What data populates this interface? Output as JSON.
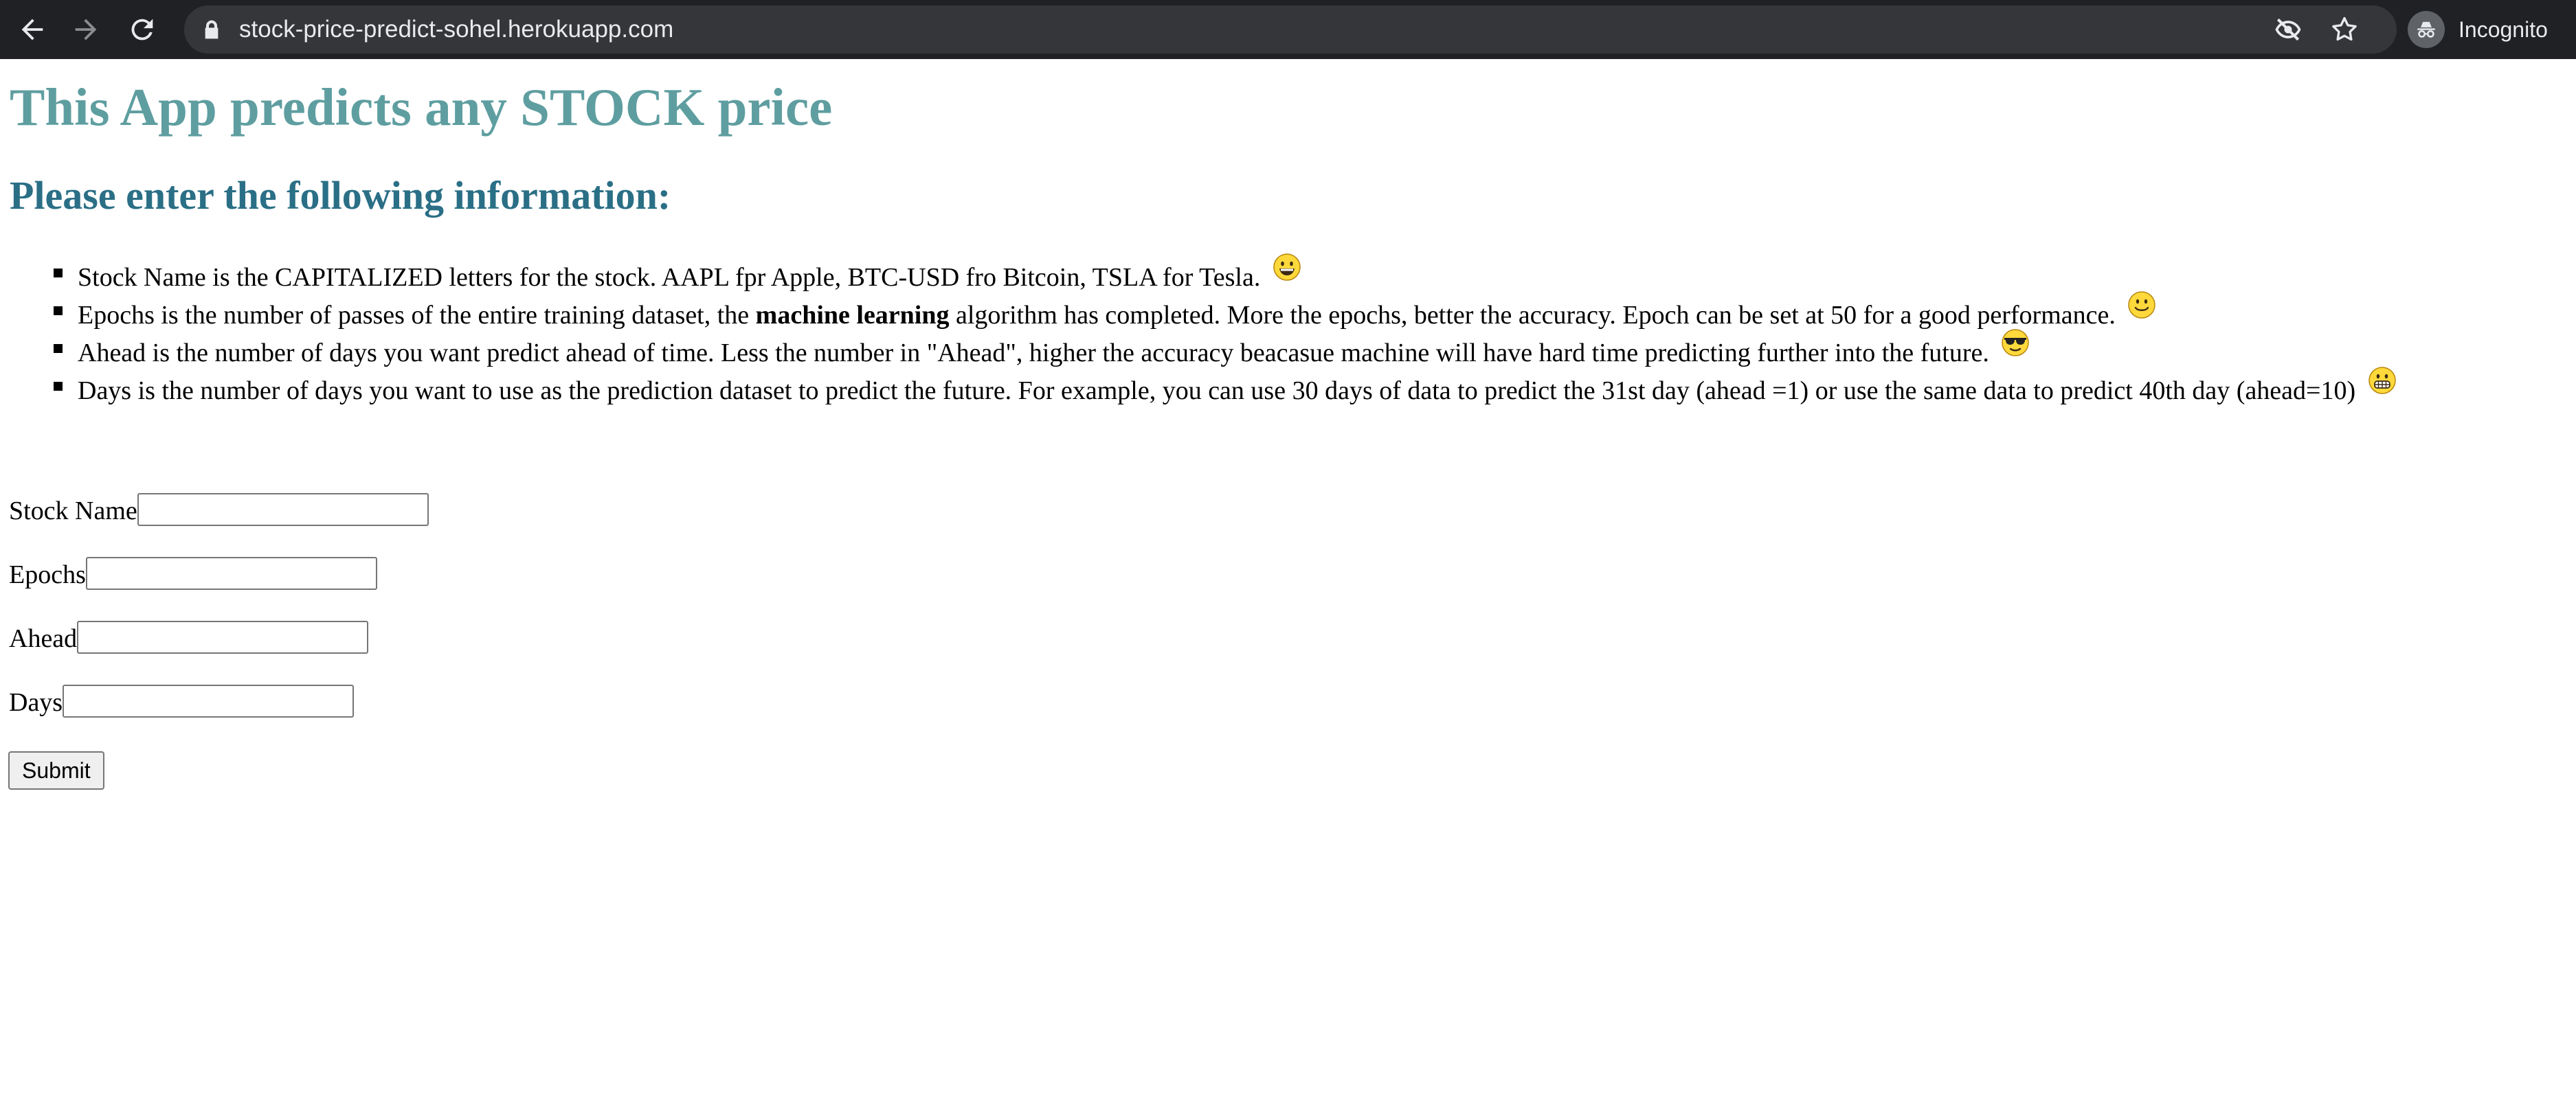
{
  "browser": {
    "url": "stock-price-predict-sohel.herokuapp.com",
    "profile_label": "Incognito",
    "icons": [
      "back-icon",
      "forward-icon",
      "reload-icon",
      "lock-icon",
      "eye-off-icon",
      "star-icon",
      "incognito-icon"
    ]
  },
  "page": {
    "title": "This App predicts any STOCK price",
    "subtitle": "Please enter the following information:",
    "info_items": [
      {
        "text": "Stock Name is the CAPITALIZED letters for the stock. AAPL fpr Apple, BTC-USD fro Bitcoin, TSLA for Tesla.",
        "emoji": "grinning-face-emoji"
      },
      {
        "pre": "Epochs is the number of passes of the entire training dataset, the ",
        "bold": "machine learning",
        "post": " algorithm has completed. More the epochs, better the accuracy. Epoch can be set at 50 for a good performance.",
        "emoji": "slightly-smiling-face-emoji"
      },
      {
        "text": "Ahead is the number of days you want predict ahead of time. Less the number in \"Ahead\", higher the accuracy beacasue machine will have hard time predicting further into the future.",
        "emoji": "sunglasses-face-emoji"
      },
      {
        "text": "Days is the number of days you want to use as the prediction dataset to predict the future. For example, you can use 30 days of data to predict the 31st day (ahead =1) or use the same data to predict 40th day (ahead=10)",
        "emoji": "grimacing-face-emoji"
      }
    ],
    "form": {
      "stock_name_label": "Stock Name",
      "stock_name_value": "",
      "epochs_label": "Epochs",
      "epochs_value": "",
      "ahead_label": "Ahead",
      "ahead_value": "",
      "days_label": "Days",
      "days_value": "",
      "submit_label": "Submit"
    }
  },
  "colors": {
    "title": "#5f9ea0",
    "subtitle": "#2a6f86",
    "chrome_bg": "#202124",
    "omnibox_bg": "#35363a"
  }
}
